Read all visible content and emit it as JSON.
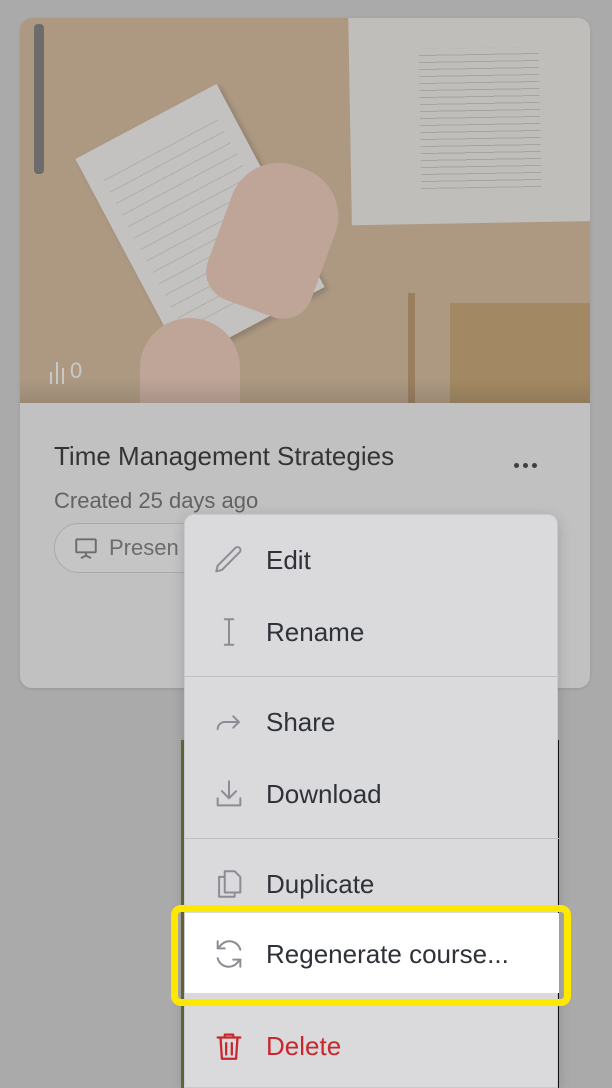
{
  "card": {
    "title": "Time Management Strategies",
    "created": "Created 25 days ago",
    "views": "0",
    "badge_label": "Presen",
    "icons": {
      "stats": "bar-chart-icon",
      "badge": "presentation-icon",
      "more": "more-horizontal-icon"
    }
  },
  "menu": {
    "items": [
      {
        "label": "Edit",
        "icon": "pencil-icon"
      },
      {
        "label": "Rename",
        "icon": "text-cursor-icon"
      },
      {
        "label": "Share",
        "icon": "share-arrow-icon"
      },
      {
        "label": "Download",
        "icon": "download-icon"
      },
      {
        "label": "Duplicate",
        "icon": "copy-icon"
      },
      {
        "label": "Regenerate course...",
        "icon": "refresh-icon"
      },
      {
        "label": "Delete",
        "icon": "trash-icon"
      }
    ],
    "highlighted": "Regenerate course...",
    "colors": {
      "highlight_border": "#ffe800",
      "danger": "#c8282d"
    }
  }
}
